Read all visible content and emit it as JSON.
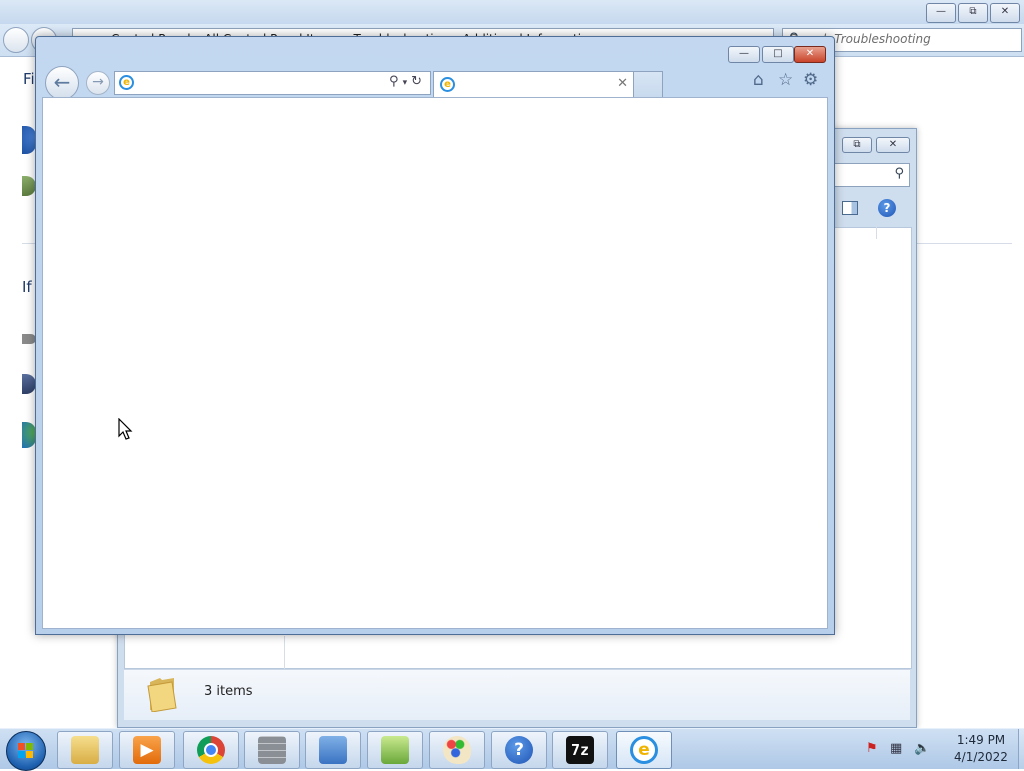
{
  "control_panel": {
    "address": "Control Panel ▸ All Control Panel Items ▸ Troubleshooting ▸ Additional Information",
    "search_placeholder": "Search Troubleshooting",
    "partial_text_1": "Fi",
    "partial_text_2": "If"
  },
  "explorer": {
    "status_text": "3 items"
  },
  "browser": {
    "address_value": "",
    "tab_title": ""
  },
  "taskbar": {
    "apps": [
      {
        "name": "Windows Explorer",
        "icon": "folder-icon"
      },
      {
        "name": "Windows Media Player",
        "icon": "media-player-icon"
      },
      {
        "name": "Google Chrome",
        "icon": "chrome-icon"
      },
      {
        "name": "Windows Firewall",
        "icon": "firewall-icon"
      },
      {
        "name": "Control Panel",
        "icon": "control-panel-icon"
      },
      {
        "name": "Notepad++",
        "icon": "notepadpp-icon"
      },
      {
        "name": "Paint",
        "icon": "paint-icon"
      },
      {
        "name": "Help and Support",
        "icon": "help-icon"
      },
      {
        "name": "7-Zip",
        "icon": "sevenzip-icon",
        "label": "7z"
      },
      {
        "name": "Internet Explorer",
        "icon": "ie-icon"
      }
    ],
    "clock_time": "1:49 PM",
    "clock_date": "4/1/2022"
  },
  "colors": {
    "window_frame": "#c3d8f0",
    "close_button": "#c9432a",
    "taskbar": "#bcd2ea"
  }
}
